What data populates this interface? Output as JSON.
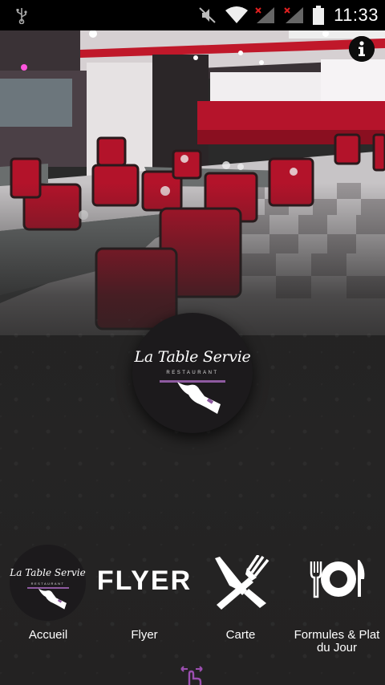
{
  "status_bar": {
    "time": "11:33",
    "icons": [
      "usb-icon",
      "mute-icon",
      "wifi-icon",
      "signal-no-service-icon",
      "signal-no-service-icon",
      "battery-icon"
    ]
  },
  "logo": {
    "name": "La Table Servie",
    "subtitle": "RESTAURANT"
  },
  "nav": {
    "items": [
      {
        "label": "Accueil",
        "icon": "logo"
      },
      {
        "label": "Flyer",
        "icon": "flyer-text",
        "icon_text": "FLYER"
      },
      {
        "label": "Carte",
        "icon": "knife-fork-icon"
      },
      {
        "label": "Formules & Plat du Jour",
        "icon": "plate-cutlery-icon"
      }
    ]
  },
  "colors": {
    "accent": "#8e5aa0",
    "background": "#232222",
    "chair_red": "#b3132a",
    "status_bar": "#000000"
  }
}
